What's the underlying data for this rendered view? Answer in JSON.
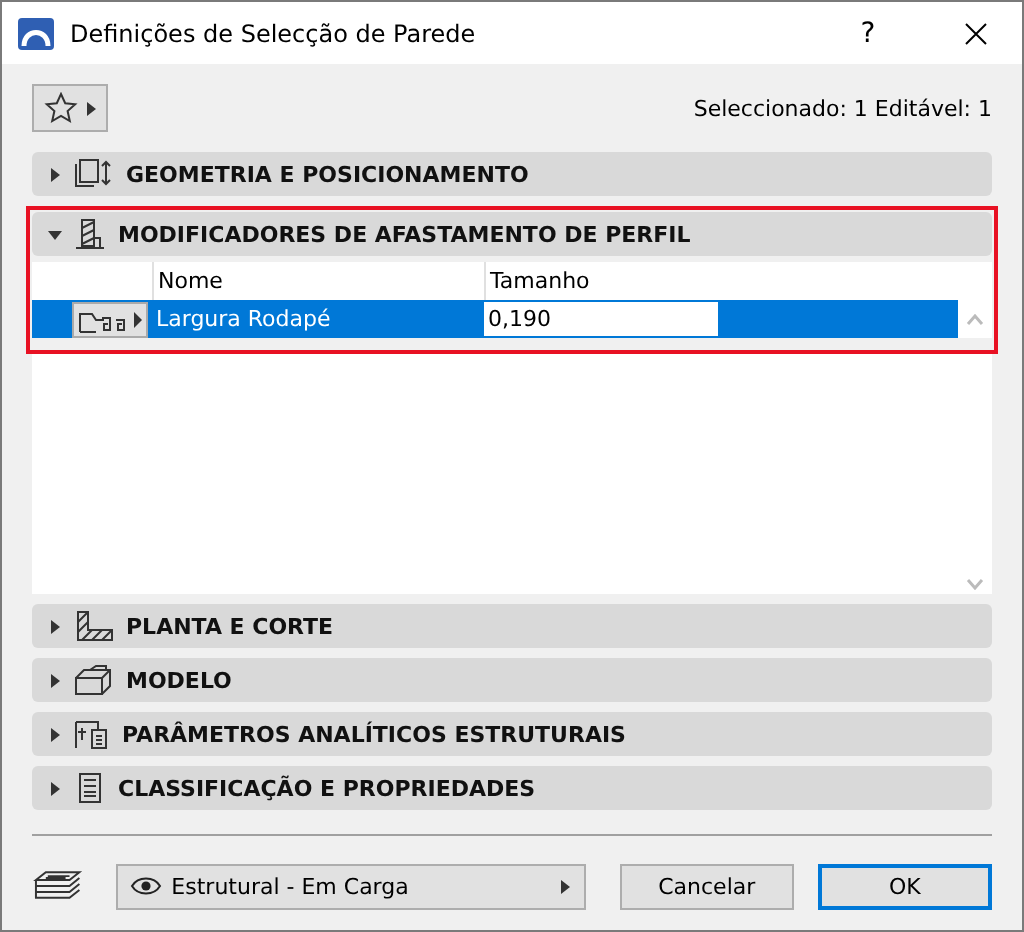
{
  "window": {
    "title": "Definições de Selecção de Parede",
    "help": "?"
  },
  "selection_info": "Seleccionado: 1 Editável: 1",
  "panels": [
    {
      "kind": "geometry",
      "title": "GEOMETRIA E POSICIONAMENTO",
      "expanded": false,
      "highlighted": false
    },
    {
      "kind": "profile",
      "title": "MODIFICADORES DE AFASTAMENTO DE PERFIL",
      "expanded": true,
      "highlighted": true,
      "table": {
        "columns": [
          "Nome",
          "Tamanho"
        ],
        "rows": [
          {
            "name": "Largura Rodapé",
            "value": "0,190",
            "selected": true
          }
        ]
      }
    },
    {
      "kind": "plan",
      "title": "PLANTA E CORTE",
      "expanded": false,
      "highlighted": false
    },
    {
      "kind": "model",
      "title": "MODELO",
      "expanded": false,
      "highlighted": false
    },
    {
      "kind": "structural",
      "title": "PARÂMETROS ANALÍTICOS ESTRUTURAIS",
      "expanded": false,
      "highlighted": false
    },
    {
      "kind": "classification",
      "title": "CLASSIFICAÇÃO E PROPRIEDADES",
      "expanded": false,
      "highlighted": false
    }
  ],
  "footer": {
    "layer": "Estrutural - Em Carga",
    "buttons": [
      {
        "label": "Cancelar",
        "default": false
      },
      {
        "label": "OK",
        "default": true
      }
    ]
  }
}
